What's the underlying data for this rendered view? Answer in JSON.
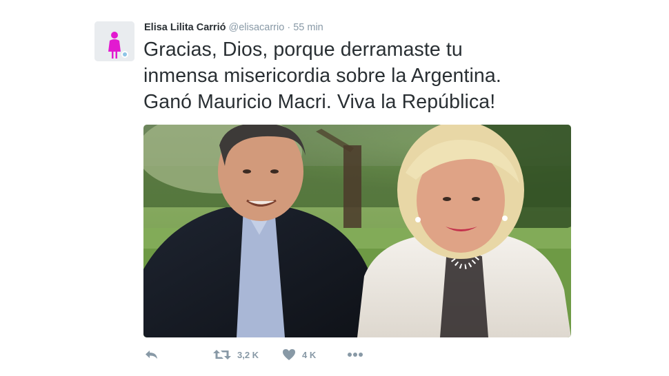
{
  "tweet": {
    "author_name": "Elisa Lilita Carrió",
    "handle": "@elisacarrio",
    "separator": "·",
    "time": "55 min",
    "text_lines": [
      "Gracias, Dios, porque derramaste tu",
      "inmensa misericordia sobre la Argentina.",
      "Ganó Mauricio Macri. Viva la República!"
    ]
  },
  "actions": {
    "retweet_count": "3,2 K",
    "like_count": "4 K"
  },
  "icons": {
    "reply": "reply-icon",
    "retweet": "retweet-icon",
    "like": "heart-icon",
    "more": "more-dots-icon"
  },
  "colors": {
    "text": "#292f33",
    "muted": "#8899a6",
    "avatar_figure": "#e21ad0"
  }
}
